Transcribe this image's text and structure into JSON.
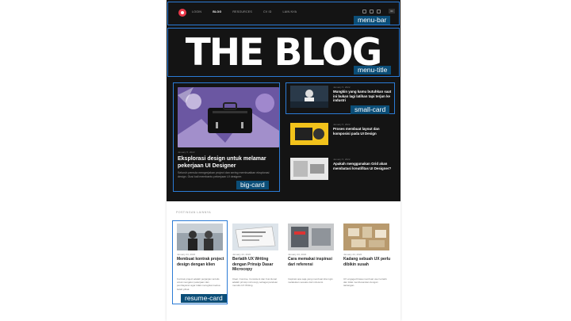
{
  "menu": {
    "items": [
      "LOGIN",
      "BLOG",
      "RESOURCES",
      "CV ID",
      "LAIN NYA"
    ],
    "lang": "ID"
  },
  "title": "THE BLOG",
  "big_card": {
    "date": "January 5, 2022",
    "headline": "Eksplorasi design untuk melamar pekerjaan UI Designer",
    "excerpt": "Seluruh pemula mengerjakan project dan sering membuatkan eksplorasi design. Gusi kali membantu pekerjaan UI designer."
  },
  "small_cards": [
    {
      "date": "January 5, 2022",
      "headline": "Mungkin yang kamu butuhkan saat ini bukan lagi latihan tapi terjun ke industri"
    },
    {
      "date": "January 5, 2022",
      "headline": "Proses membuat layout dan komposisi pada UI Design"
    },
    {
      "date": "January 5, 2022",
      "headline": "Apakah menggunakan Grid akan membatasi kreatifitas UI Designer?"
    }
  ],
  "section_label": "POSTINGAN LAINNYA",
  "resume_cards": [
    {
      "date": "January 24, 2022",
      "headline": "Membuat kontrak project design dengan klien",
      "excerpt": "Kontrak project adalah perjanjian tertulis untuk mengatur pekerjaan dan pembayaran agar tidak merugikan kedua belah pihak."
    },
    {
      "date": "January 24, 2022",
      "headline": "Berlatih UX Writing dengan Prinsip Dasar Microcopy",
      "excerpt": "Clear, Concise, Consistent dan Functional adalah prinsip microcopy sebagai panduan menulis UX Writing."
    },
    {
      "date": "January 24, 2022",
      "headline": "Cara memakai inspirasi dari referensi",
      "excerpt": "Inspirasi apa saja yang membuat kita ingin melakukan sesuatu dari referensi."
    },
    {
      "date": "January 24, 2022",
      "headline": "Kadang sebuah UX perlu dibikin susah",
      "excerpt": "UX engaged biasa membuat user tertarik dan tidak membosankan dengan tantangan."
    }
  ],
  "annotations": {
    "menu_bar": "menu-bar",
    "menu_title": "menu-title",
    "small_card": "small-card",
    "big_card": "big-card",
    "resume_card": "resume-card"
  },
  "colors": {
    "dark_bg": "#141414",
    "accent": "#e8394a",
    "annotation_box": "#2b7bd6",
    "annotation_tag": "#0b4e78"
  }
}
